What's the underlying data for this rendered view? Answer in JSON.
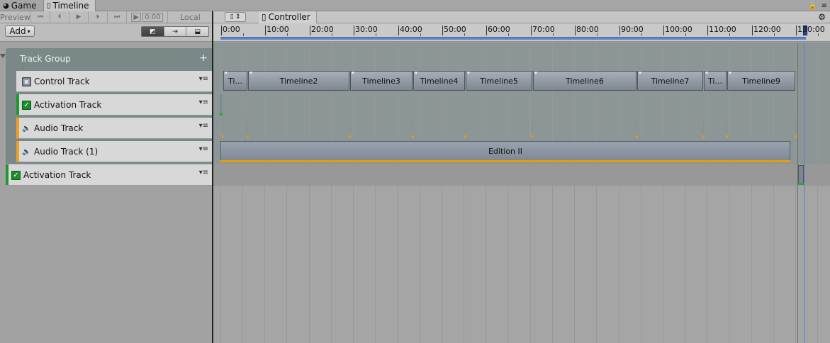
{
  "window_tabs": [
    {
      "label": "Game",
      "icon": "pacman-icon"
    },
    {
      "label": "Timeline",
      "icon": "timeline-icon"
    }
  ],
  "toolbar": {
    "preview_label": "Preview",
    "frame_value": "0:00",
    "local_label": "Local",
    "add_label": "Add"
  },
  "breadcrumb": {
    "current": "Controller"
  },
  "group": {
    "title": "Track Group",
    "add_glyph": "+"
  },
  "tracks": [
    {
      "name": "Control Track",
      "type": "control",
      "stripe": "#d8d8d8"
    },
    {
      "name": "Activation Track",
      "type": "activation",
      "stripe": "#1d9a2e"
    },
    {
      "name": "Audio Track",
      "type": "audio",
      "stripe": "#f0a020"
    },
    {
      "name": "Audio Track (1)",
      "type": "audio",
      "stripe": "#f0a020"
    },
    {
      "name": "Activation Track",
      "type": "activation",
      "stripe": "#1d9a2e"
    }
  ],
  "ruler": {
    "labels": [
      "0:00",
      "10:00",
      "20:00",
      "30:00",
      "40:00",
      "50:00",
      "60:00",
      "70:00",
      "80:00",
      "90:00",
      "100:00",
      "110:00",
      "120:00",
      "130:00"
    ]
  },
  "control_clips": [
    "Ti...",
    "Timeline2",
    "Timeline3",
    "Timeline4",
    "Timeline5",
    "Timeline6",
    "Timeline7",
    "Ti...",
    "Timeline9"
  ],
  "audio_clip": {
    "label": "Edition II"
  },
  "colors": {
    "activation": "#1d9a2e",
    "audio": "#f0a020",
    "group": "#7b8888",
    "playhead": "#5a7ccb"
  }
}
